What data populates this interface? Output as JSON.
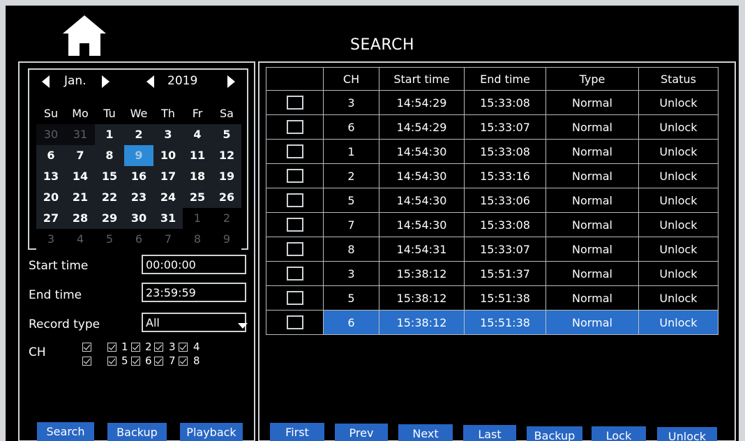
{
  "header": {
    "title": "SEARCH",
    "home_icon": "home-icon"
  },
  "calendar": {
    "month": "Jan.",
    "year": "2019",
    "weekdays": [
      "Su",
      "Mo",
      "Tu",
      "We",
      "Th",
      "Fr",
      "Sa"
    ],
    "days": [
      {
        "d": "30",
        "other": true
      },
      {
        "d": "31",
        "other": true
      },
      {
        "d": "1"
      },
      {
        "d": "2"
      },
      {
        "d": "3"
      },
      {
        "d": "4"
      },
      {
        "d": "5"
      },
      {
        "d": "6"
      },
      {
        "d": "7"
      },
      {
        "d": "8"
      },
      {
        "d": "9",
        "selected": true
      },
      {
        "d": "10"
      },
      {
        "d": "11"
      },
      {
        "d": "12"
      },
      {
        "d": "13"
      },
      {
        "d": "14"
      },
      {
        "d": "15"
      },
      {
        "d": "16"
      },
      {
        "d": "17"
      },
      {
        "d": "18"
      },
      {
        "d": "19"
      },
      {
        "d": "20"
      },
      {
        "d": "21"
      },
      {
        "d": "22"
      },
      {
        "d": "23"
      },
      {
        "d": "24"
      },
      {
        "d": "25"
      },
      {
        "d": "26"
      },
      {
        "d": "27"
      },
      {
        "d": "28"
      },
      {
        "d": "29"
      },
      {
        "d": "30"
      },
      {
        "d": "31"
      },
      {
        "d": "1",
        "other": true
      },
      {
        "d": "2",
        "other": true
      },
      {
        "d": "3",
        "other": true
      },
      {
        "d": "4",
        "other": true
      },
      {
        "d": "5",
        "other": true
      },
      {
        "d": "6",
        "other": true
      },
      {
        "d": "7",
        "other": true
      },
      {
        "d": "8",
        "other": true
      },
      {
        "d": "9",
        "other": true
      }
    ]
  },
  "filters": {
    "start_label": "Start time",
    "start_value": "00:00:00",
    "end_label": "End time",
    "end_value": "23:59:59",
    "type_label": "Record type",
    "type_value": "All",
    "ch_label": "CH",
    "channels": [
      "1",
      "2",
      "3",
      "4",
      "5",
      "6",
      "7",
      "8"
    ]
  },
  "left_buttons": {
    "search": "Search",
    "backup": "Backup",
    "playback": "Playback"
  },
  "table": {
    "columns": [
      "",
      "CH",
      "Start time",
      "End time",
      "Type",
      "Status"
    ],
    "rows": [
      {
        "ch": "3",
        "start": "14:54:29",
        "end": "15:33:08",
        "type": "Normal",
        "status": "Unlock"
      },
      {
        "ch": "6",
        "start": "14:54:29",
        "end": "15:33:07",
        "type": "Normal",
        "status": "Unlock"
      },
      {
        "ch": "1",
        "start": "14:54:30",
        "end": "15:33:08",
        "type": "Normal",
        "status": "Unlock"
      },
      {
        "ch": "2",
        "start": "14:54:30",
        "end": "15:33:16",
        "type": "Normal",
        "status": "Unlock"
      },
      {
        "ch": "5",
        "start": "14:54:30",
        "end": "15:33:06",
        "type": "Normal",
        "status": "Unlock"
      },
      {
        "ch": "7",
        "start": "14:54:30",
        "end": "15:33:08",
        "type": "Normal",
        "status": "Unlock"
      },
      {
        "ch": "8",
        "start": "14:54:31",
        "end": "15:33:07",
        "type": "Normal",
        "status": "Unlock"
      },
      {
        "ch": "3",
        "start": "15:38:12",
        "end": "15:51:37",
        "type": "Normal",
        "status": "Unlock"
      },
      {
        "ch": "5",
        "start": "15:38:12",
        "end": "15:51:38",
        "type": "Normal",
        "status": "Unlock"
      },
      {
        "ch": "6",
        "start": "15:38:12",
        "end": "15:51:38",
        "type": "Normal",
        "status": "Unlock",
        "selected": true
      }
    ]
  },
  "pager_buttons": {
    "first": "First",
    "prev": "Prev",
    "next": "Next",
    "last": "Last",
    "backup": "Backup",
    "lock": "Lock",
    "unlock": "Unlock"
  },
  "colors": {
    "accent": "#2866c4",
    "selected_day": "#2d8ad6",
    "selected_row": "#2a6fc9",
    "background": "#000000"
  }
}
